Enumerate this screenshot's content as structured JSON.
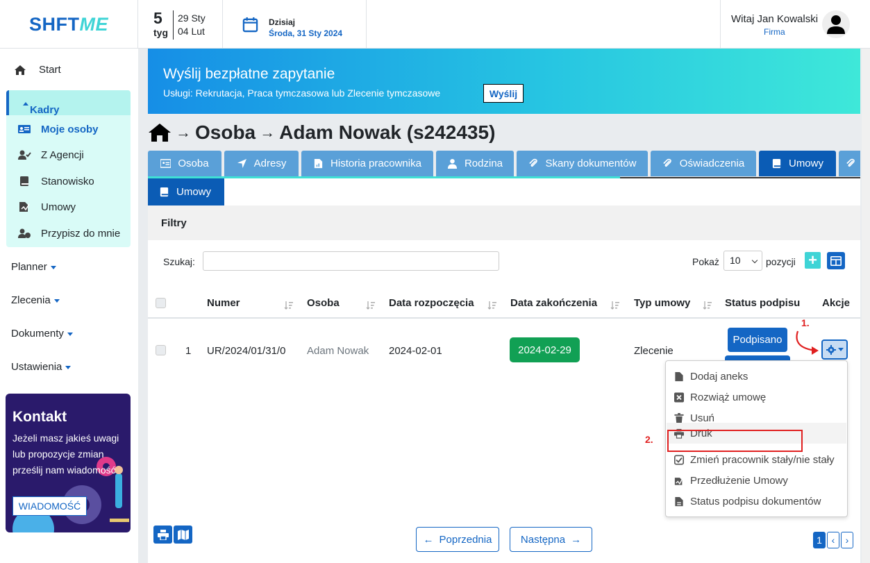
{
  "header": {
    "logo_a": "SHFT",
    "logo_b": "ME",
    "week_num": "5",
    "week_lbl": "tyg",
    "week_d1": "29 Sty",
    "week_d2": "04 Lut",
    "today_label": "Dzisiaj",
    "today_date": "Środa, 31 Sty 2024",
    "greeting": "Witaj Jan Kowalski",
    "firm": "Firma"
  },
  "sidebar": {
    "start": "Start",
    "kadry": "Kadry",
    "kadry_items": [
      "Moje osoby",
      "Z Agencji",
      "Stanowisko",
      "Umowy",
      "Przypisz do mnie"
    ],
    "menus": [
      "Planner",
      "Zlecenia",
      "Dokumenty",
      "Ustawienia"
    ],
    "kontakt_title": "Kontakt",
    "kontakt_text": "Jeżeli masz jakieś uwagi lub propozycje zmian prześlij nam wiadomość",
    "kontakt_btn": "WIADOMOŚĆ"
  },
  "banner": {
    "title": "Wyślij bezpłatne zapytanie",
    "subtitle": "Usługi: Rekrutacja, Praca tymczasowa lub Zlecenie tymczasowe",
    "button": "Wyślij"
  },
  "page": {
    "crumb1": "Osoba",
    "crumb2": "Adam Nowak (s242435)"
  },
  "tabs": [
    "Osoba",
    "Adresy",
    "Historia pracownika",
    "Rodzina",
    "Skany dokumentów",
    "Oświadczenia",
    "Umowy"
  ],
  "subtab": "Umowy",
  "filters_title": "Filtry",
  "search_label": "Szukaj:",
  "show_label": "Pokaż",
  "show_value": "10",
  "positions_label": "pozycji",
  "table": {
    "headers": [
      "Numer",
      "Osoba",
      "Data rozpoczęcia",
      "Data zakończenia",
      "Typ umowy",
      "Status podpisu",
      "Akcje"
    ],
    "row": {
      "idx": "1",
      "numer": "UR/2024/01/31/0",
      "osoba": "Adam Nowak",
      "start": "2024-02-01",
      "end": "2024-02-29",
      "typ": "Zlecenie",
      "status": "Podpisano"
    }
  },
  "annotations": {
    "a1": "1.",
    "a2": "2."
  },
  "dropdown": [
    "Dodaj aneks",
    "Rozwiąż umowę",
    "Usuń",
    "Druk",
    "Zmień pracownik stały/nie stały",
    "Przedłużenie Umowy",
    "Status podpisu dokumentów"
  ],
  "pagination": {
    "prev": "Poprzednia",
    "next": "Następna",
    "page": "1"
  },
  "colors": {
    "primary": "#1466c4",
    "accent": "#3fd4d6",
    "success": "#11a054",
    "annotation": "#e02020"
  }
}
